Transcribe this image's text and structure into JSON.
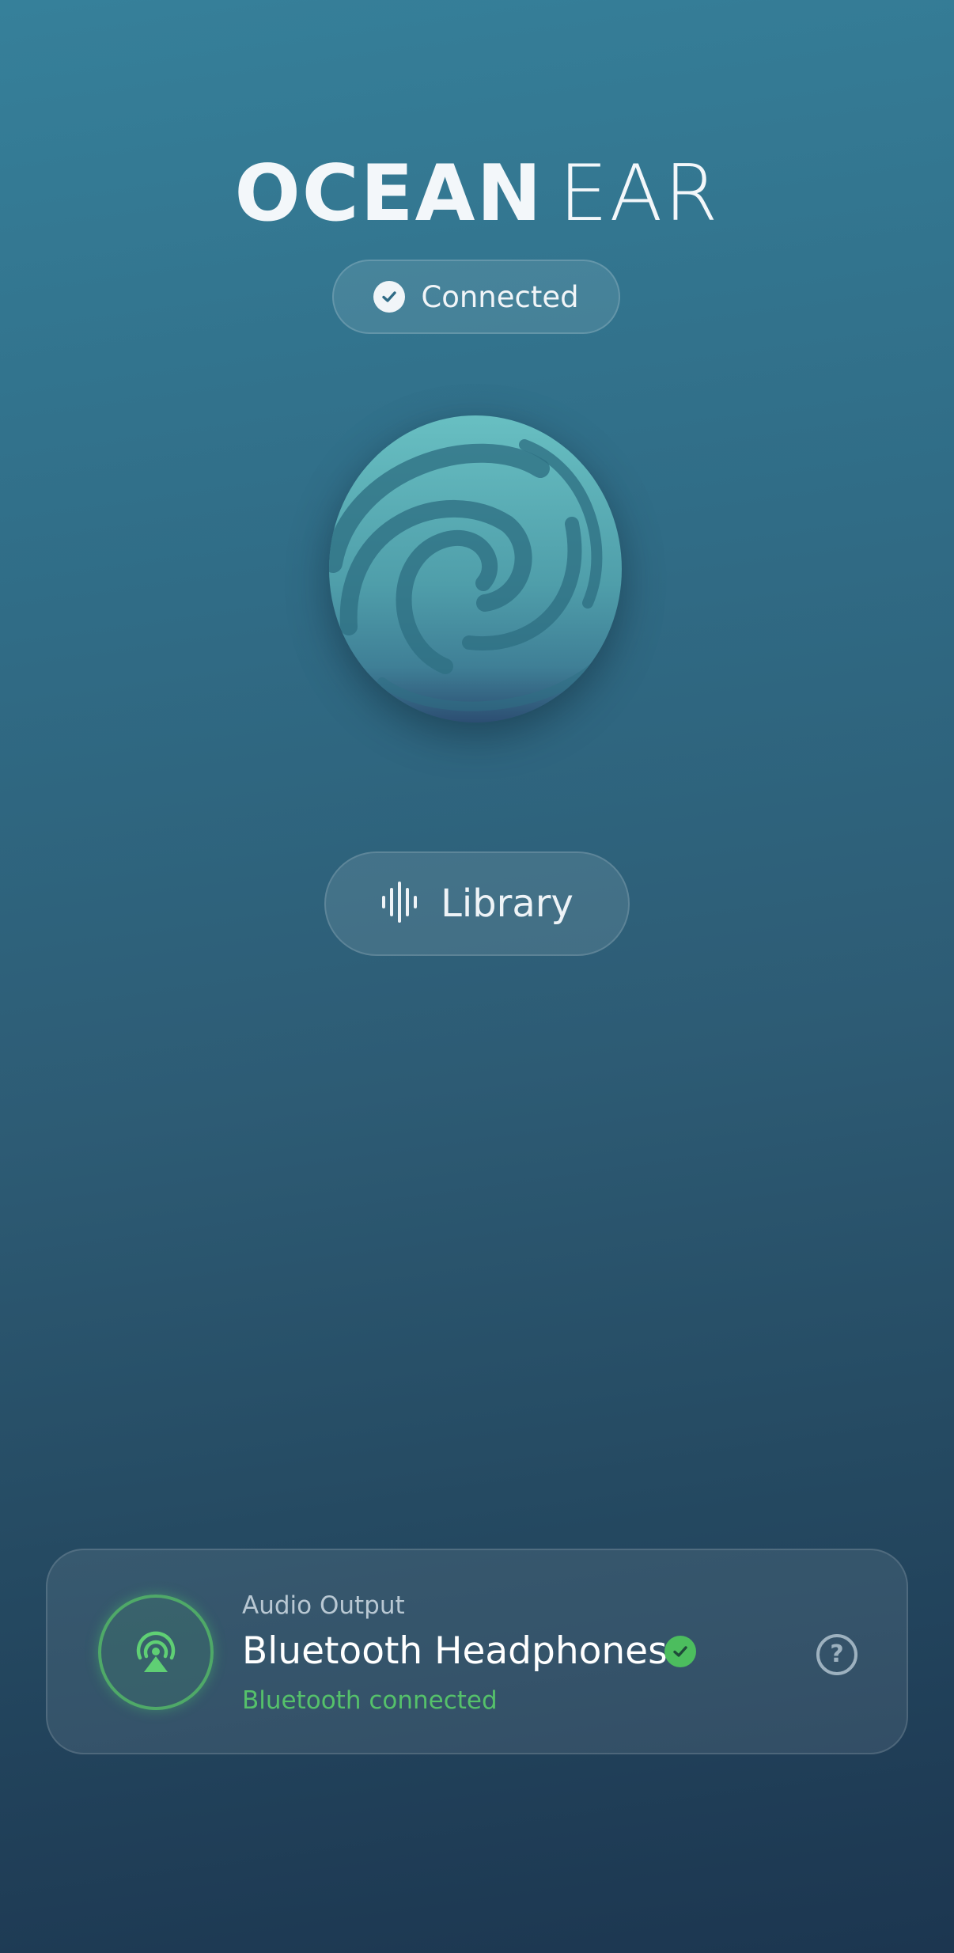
{
  "app": {
    "title_bold": "OCEAN",
    "title_light": "EAR"
  },
  "status": {
    "label": "Connected",
    "icon": "check-circle-icon"
  },
  "logo": {
    "icon": "ocean-wave-swirl-logo"
  },
  "library": {
    "label": "Library",
    "icon": "waveform-icon"
  },
  "audio_output": {
    "section_label": "Audio Output",
    "device_name": "Bluetooth Headphones",
    "device_status": "Bluetooth connected",
    "device_icon": "airplay-audio-icon",
    "verified_icon": "check-badge-icon",
    "help_icon": "help-circle-icon"
  },
  "colors": {
    "background_top": "#36809a",
    "background_bottom": "#1c3650",
    "success_green": "#4cbd5e",
    "logo_teal": "#5bb1b7"
  }
}
